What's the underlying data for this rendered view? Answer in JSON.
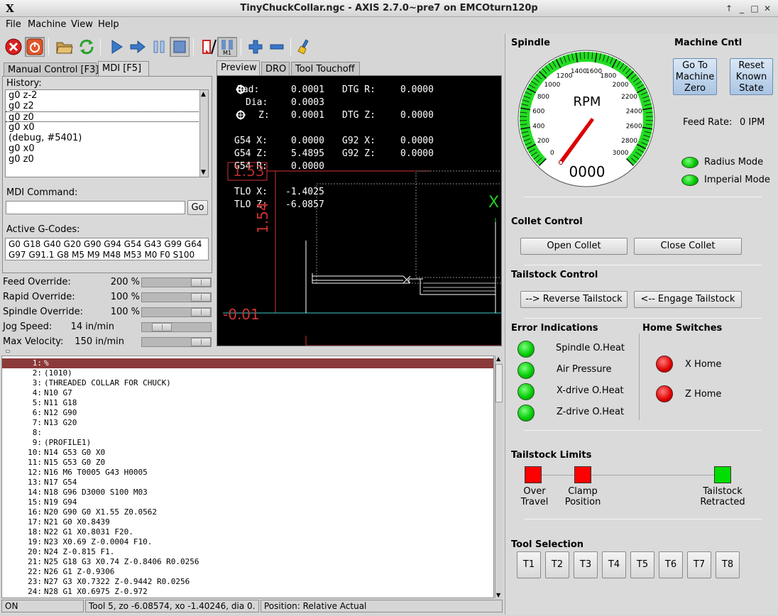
{
  "window": {
    "title": "TinyChuckCollar.ngc - AXIS 2.7.0~pre7 on EMCOturn120p",
    "app_icon": "X"
  },
  "menu": [
    "File",
    "Machine",
    "View",
    "Help"
  ],
  "toolbar": {
    "icons": [
      "estop-icon",
      "machine-power-icon",
      "open-file-icon",
      "reload-icon",
      "run-icon",
      "step-icon",
      "pause-icon",
      "stop-icon",
      "block-delete-icon",
      "optional-stop-icon",
      "zoom-in-icon",
      "zoom-out-icon",
      "clear-plot-icon"
    ],
    "optional_stop_label": "M1"
  },
  "left_tabs": [
    "Manual Control [F3]",
    "MDI [F5]"
  ],
  "mdi": {
    "history_label": "History:",
    "history": [
      "g0 z-2",
      "g0 z2",
      "g0 z0",
      "g0 x0",
      "(debug, #5401)",
      "g0 x0",
      "g0 z0"
    ],
    "command_label": "MDI Command:",
    "command_value": "",
    "go_label": "Go",
    "active_gcodes_label": "Active G-Codes:",
    "active_gcodes": [
      "G0 G18 G40 G20 G90 G94 G54 G43 G99 G64",
      "G97 G91.1 G8 M5 M9 M48 M53 M0 F0 S100"
    ]
  },
  "overrides": [
    {
      "label": "Feed Override:",
      "value": "200 %",
      "level": 1.0
    },
    {
      "label": "Rapid Override:",
      "value": "100 %",
      "level": 1.0
    },
    {
      "label": "Spindle Override:",
      "value": "100 %",
      "level": 1.0
    },
    {
      "label": "Jog Speed:",
      "value": "14 in/min",
      "level": 0.2
    },
    {
      "label": "Max Velocity:",
      "value": "150 in/min",
      "level": 1.0
    }
  ],
  "preview_tabs": [
    "Preview",
    "DRO",
    "Tool Touchoff"
  ],
  "dro": {
    "rad": "0.0001",
    "dtg_r": "0.0000",
    "dia": "0.0003",
    "z": "0.0001",
    "dtg_z": "0.0000",
    "g54_x": "0.0000",
    "g92_x": "0.0000",
    "g54_z": "5.4895",
    "g92_z": "0.0000",
    "g54_r": "0.0000",
    "tlo_x": "-1.4025",
    "tlo_z": "-6.0857",
    "labels": {
      "rad": "Rad:",
      "dtg_r": "DTG R:",
      "dia": "Dia:",
      "z": "Z:",
      "dtg_z": "DTG Z:",
      "g54_x": "G54 X:",
      "g92_x": "G92 X:",
      "g54_z": "G54 Z:",
      "g92_z": "G92 Z:",
      "g54_r": "G54 R:",
      "tlo_x": "TLO X:",
      "tlo_z": "TLO Z:"
    },
    "dim_horizontal": "1.53",
    "dim_vertical": "1.54",
    "dim_origin": "-0.01",
    "axis_letter": "X"
  },
  "gcode": [
    {
      "n": "1:",
      "text": "%"
    },
    {
      "n": "2:",
      "text": "(1010)"
    },
    {
      "n": "3:",
      "text": "(THREADED COLLAR FOR CHUCK)"
    },
    {
      "n": "4:",
      "text": "N10 G7"
    },
    {
      "n": "5:",
      "text": "N11 G18"
    },
    {
      "n": "6:",
      "text": "N12 G90"
    },
    {
      "n": "7:",
      "text": "N13 G20"
    },
    {
      "n": "8:",
      "text": ""
    },
    {
      "n": "9:",
      "text": "(PROFILE1)"
    },
    {
      "n": "10:",
      "text": "N14 G53 G0 X0"
    },
    {
      "n": "11:",
      "text": "N15 G53 G0 Z0"
    },
    {
      "n": "12:",
      "text": "N16 M6 T0005 G43 H0005"
    },
    {
      "n": "13:",
      "text": "N17 G54"
    },
    {
      "n": "14:",
      "text": "N18 G96 D3000 S100 M03"
    },
    {
      "n": "15:",
      "text": "N19 G94"
    },
    {
      "n": "16:",
      "text": "N20 G90 G0 X1.55 Z0.0562"
    },
    {
      "n": "17:",
      "text": "N21 G0 X0.8439"
    },
    {
      "n": "18:",
      "text": "N22 G1 X0.8031 F20."
    },
    {
      "n": "19:",
      "text": "N23 X0.69 Z-0.0004 F10."
    },
    {
      "n": "20:",
      "text": "N24 Z-0.815 F1."
    },
    {
      "n": "21:",
      "text": "N25 G18 G3 X0.74 Z-0.8406 R0.0256"
    },
    {
      "n": "22:",
      "text": "N26 G1 Z-0.9306"
    },
    {
      "n": "23:",
      "text": "N27 G3 X0.7322 Z-0.9442 R0.0256"
    },
    {
      "n": "24:",
      "text": "N28 G1 X0.6975 Z-0.972"
    }
  ],
  "status": {
    "state": "ON",
    "tool": "Tool 5, zo -6.08574, xo -1.40246, dia 0.",
    "position": "Position: Relative Actual"
  },
  "right": {
    "spindle_title": "Spindle",
    "gauge": {
      "unit": "RPM",
      "readout": "0000",
      "ticks": [
        "0",
        "200",
        "400",
        "600",
        "800",
        "1000",
        "1200",
        "1400",
        "1600",
        "1800",
        "2000",
        "2200",
        "2400",
        "2600",
        "2800",
        "3000"
      ],
      "max": 3000,
      "value": 0
    },
    "machine_cntl_title": "Machine Cntl",
    "go_to_zero": "Go To Machine Zero",
    "reset_known": "Reset Known State",
    "feed_rate_label": "Feed Rate:",
    "feed_rate_value": "0 IPM",
    "radius_mode": "Radius Mode",
    "imperial_mode": "Imperial Mode",
    "collet_title": "Collet Control",
    "open_collet": "Open Collet",
    "close_collet": "Close Collet",
    "tailstock_title": "Tailstock Control",
    "reverse_tailstock": "--> Reverse Tailstock",
    "engage_tailstock": "<-- Engage Tailstock",
    "error_title": "Error Indications",
    "errors": [
      "Spindle O.Heat",
      "Air Pressure",
      "X-drive O.Heat",
      "Z-drive O.Heat"
    ],
    "home_title": "Home Switches",
    "homes": [
      "X Home",
      "Z Home"
    ],
    "limits_title": "Tailstock Limits",
    "limits": [
      {
        "label": "Over Travel",
        "color": "#ff0000"
      },
      {
        "label": "Clamp Position",
        "color": "#ff0000"
      },
      {
        "label": "Tailstock Retracted",
        "color": "#00dd00"
      }
    ],
    "tool_sel_title": "Tool Selection",
    "tools": [
      "T1",
      "T2",
      "T3",
      "T4",
      "T5",
      "T6",
      "T7",
      "T8"
    ]
  },
  "colors": {
    "highlight_line": "#8b3a3a",
    "dim_red": "#d23232",
    "gauge_green": "#22dd22",
    "needle_red": "#dd0000"
  }
}
